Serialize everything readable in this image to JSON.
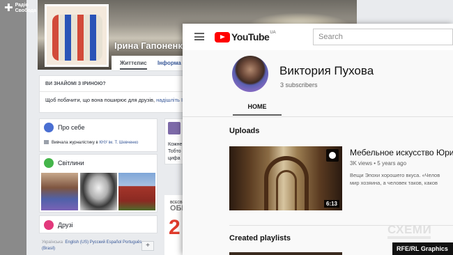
{
  "facebook": {
    "profile_name": "Ірина Гапоненко",
    "nav": {
      "timeline": "Життєпис",
      "info": "Інформа"
    },
    "know_header": "ВИ ЗНАЙОМІ З ІРИНОЮ?",
    "know_text": "Щоб побачити, що вона поширює для друзів, ",
    "know_link": "надішліть їй",
    "about_title": "Про себе",
    "about_text": "Вивчала журналістику в ",
    "about_link": "КНУ ім. Т. Шевченко",
    "photos_title": "Світлини",
    "friends_title": "Друзі",
    "languages": {
      "current": "Українська",
      "list": "English (US)  Русский  Español  Português (Brasil)"
    },
    "plus_label": "+",
    "post_text": "Кожне\nТобто\nцифа",
    "ad_line1": "ВСЕСВІТ",
    "ad_line2": "ОБІЦ",
    "ad_line3": "2",
    "rferl_brand": "Радіо\nСвобода"
  },
  "youtube": {
    "logo_text": "YouTube",
    "region": "UA",
    "search_placeholder": "Search",
    "channel_name": "Виктория Пухова",
    "subscribers": "3 subscribers",
    "tab_home": "HOME",
    "uploads_title": "Uploads",
    "video": {
      "title": "Мебельное искусство Юри",
      "views": "3K views",
      "age": "5 years ago",
      "desc_line1": "Вещи Эпохи хорошего вкуса. «Челов",
      "desc_line2": "мир хозяина, а человек таков, каков",
      "duration": "6:13"
    },
    "playlists_title": "Created playlists"
  },
  "watermarks": {
    "schemy": "СХЕМИ",
    "rferl_graphics": "RFE/RL Graphics"
  },
  "colors": {
    "youtube_red": "#ff0000",
    "facebook_link": "#385898",
    "facebook_bg": "#e9ebee"
  }
}
